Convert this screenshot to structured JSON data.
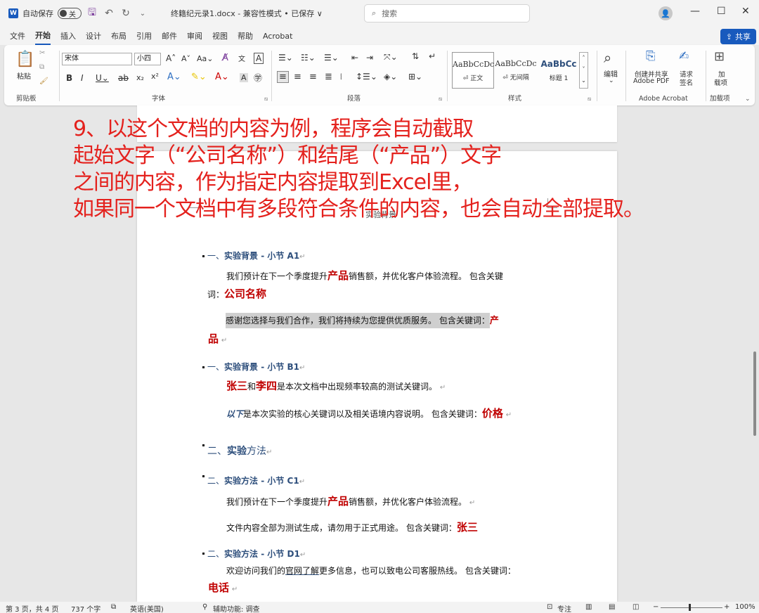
{
  "titlebar": {
    "autosave_label": "自动保存",
    "autosave_state": "关",
    "doc_title": "终籍纪元录1.docx  -  兼容性模式 • 已保存 ∨",
    "search_placeholder": "搜索",
    "minimize": "—",
    "restore": "☐",
    "close": "✕"
  },
  "menu": {
    "tabs": [
      "文件",
      "开始",
      "插入",
      "设计",
      "布局",
      "引用",
      "邮件",
      "审阅",
      "视图",
      "帮助",
      "Acrobat"
    ],
    "share": "共享"
  },
  "ribbon": {
    "paste": "粘贴",
    "clipboard": "剪贴板",
    "font_name": "宋体",
    "font_size": "小四",
    "font_group": "字体",
    "paragraph_group": "段落",
    "styles": [
      {
        "sample": "AaBbCcDc",
        "name": "⏎ 正文"
      },
      {
        "sample": "AaBbCcDc",
        "name": "⏎ 无间隔"
      },
      {
        "sample": "AaBbCc",
        "name": "标题 1"
      }
    ],
    "styles_group": "样式",
    "edit": "编辑",
    "create_share_1": "创建并共享",
    "create_share_2": "Adobe PDF",
    "request_sign_1": "请求",
    "request_sign_2": "签名",
    "acrobat_group": "Adobe Acrobat",
    "addins_1": "加",
    "addins_2": "载项",
    "addins_group": "加载项"
  },
  "overlay": {
    "line1": "9、以这个文档的内容为例，程序会自动截取",
    "line2": "起始文字（“公司名称”）和结尾（“产品”）文字",
    "line3": "之间的内容，作为指定内容提取到Excel里，",
    "line4": "如果同一个文档中有多段符合条件的内容，也会自动全部提取。"
  },
  "document": {
    "header": "实验背景",
    "h1": {
      "num": "一、",
      "title": "实验背景 - 小节 A1"
    },
    "p1a": "我们预计在下一个季度提升",
    "p1kw": "产品",
    "p1b": "销售额，并优化客户体验流程。 包含关键",
    "p1c": "词：",
    "p1kw2": "公司名称",
    "p2": "感谢您选择与我们合作，我们将持续为您提供优质服务。 包含关键词：",
    "p2kw_a": "产",
    "p2kw_b": "品",
    "h2": {
      "num": "一、",
      "title": "实验背景 - 小节 B1"
    },
    "p3kw1": "张三",
    "p3and": "和",
    "p3kw2": "李四",
    "p3b": "是本次文档中出现频率较高的测试关键词。",
    "p4kw": "以下",
    "p4b": "是本次实验的核心关键词以及相关语境内容说明。 包含关键词：",
    "p4kw2": "价格",
    "h3": {
      "num": "二、",
      "title": "实验",
      "title2": "方法"
    },
    "h4": {
      "num": "二、",
      "title": "实验方法 - 小节 C1"
    },
    "p5a": "我们预计在下一个季度提升",
    "p5kw": "产品",
    "p5b": "销售额，并优化客户体验流程。",
    "p6": "文件内容全部为测试生成，请勿用于正式用途。 包含关键词：",
    "p6kw": "张三",
    "h5": {
      "num": "二、",
      "title": "实验方法 - 小节 D1"
    },
    "p7a": "欢迎访问我们的",
    "p7link": "官网了解",
    "p7b": "更多信息，也可以致电公司客服热线。 包含关键词：",
    "p7kw": "电话"
  },
  "status": {
    "page": "第 3 页，共 4 页",
    "words": "737 个字",
    "lang": "英语(美国)",
    "access": "辅助功能: 调查",
    "focus": "专注",
    "zoom": "100%"
  }
}
